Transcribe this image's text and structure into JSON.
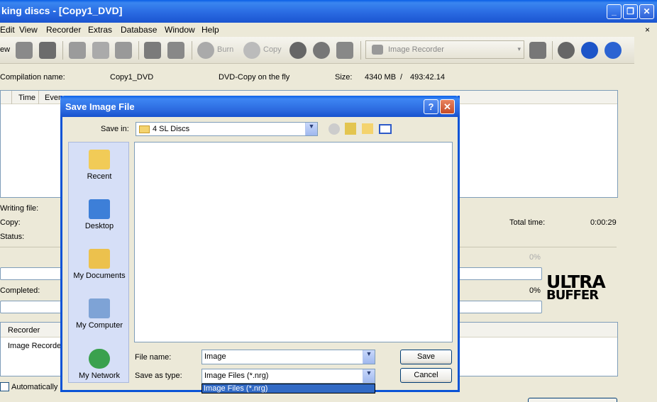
{
  "window": {
    "title": "king discs - [Copy1_DVD]"
  },
  "menu": [
    "Edit",
    "View",
    "Recorder",
    "Extras",
    "Database",
    "Window",
    "Help"
  ],
  "toolbar": {
    "burn_label": "Burn",
    "copy_label": "Copy",
    "recorder_value": "Image Recorder"
  },
  "info": {
    "compilation_label": "Compilation name:",
    "compilation_value": "Copy1_DVD",
    "mode": "DVD-Copy on the fly",
    "size_label": "Size:",
    "size_value": "4340 MB",
    "size_sep": "/",
    "size_time": "493:42.14"
  },
  "log": {
    "col_time": "Time",
    "col_event": "Even"
  },
  "status": {
    "writing_file": "Writing file:",
    "copy": "Copy:",
    "status": "Status:",
    "total_time_label": "Total time:",
    "total_time_value": "0:00:29",
    "progress1_pct": "0%",
    "completed": "Completed:",
    "progress2_pct": "0%"
  },
  "recorder_panel": {
    "header": "Recorder",
    "row": "Image Recorder"
  },
  "auto_check_label": "Automatically s",
  "ultra": {
    "line1": "ULTRA",
    "line2": "BUFFER"
  },
  "dialog": {
    "title": "Save Image File",
    "save_in_label": "Save in:",
    "save_in_value": "4 SL Discs",
    "places": [
      "Recent",
      "Desktop",
      "My Documents",
      "My Computer",
      "My Network"
    ],
    "file_name_label": "File name:",
    "file_name_value": "Image",
    "save_as_type_label": "Save as type:",
    "save_as_type_value": "Image Files (*.nrg)",
    "dropdown_option": "Image Files (*.nrg)",
    "save_button": "Save",
    "cancel_button": "Cancel"
  }
}
